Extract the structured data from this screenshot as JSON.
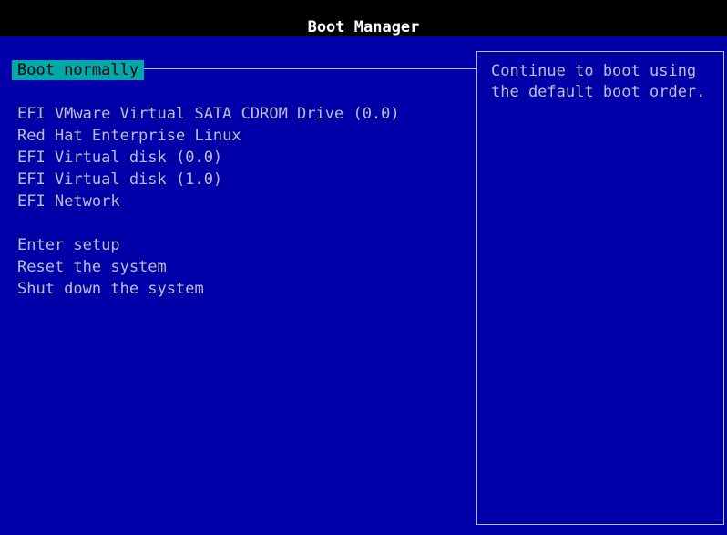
{
  "header": {
    "title": "Boot Manager"
  },
  "menu": {
    "selected": "Boot normally",
    "boot_options": [
      "EFI VMware Virtual SATA CDROM Drive (0.0)",
      "Red Hat Enterprise Linux",
      "EFI Virtual disk (0.0)",
      "EFI Virtual disk (1.0)",
      "EFI Network"
    ],
    "system_options": [
      "Enter setup",
      "Reset the system",
      "Shut down the system"
    ]
  },
  "help": {
    "text": "Continue to boot using\nthe default boot order."
  },
  "colors": {
    "background": "#0000a8",
    "highlight": "#00a8a8",
    "text": "#bdbdd2",
    "title_bar": "#000000"
  }
}
